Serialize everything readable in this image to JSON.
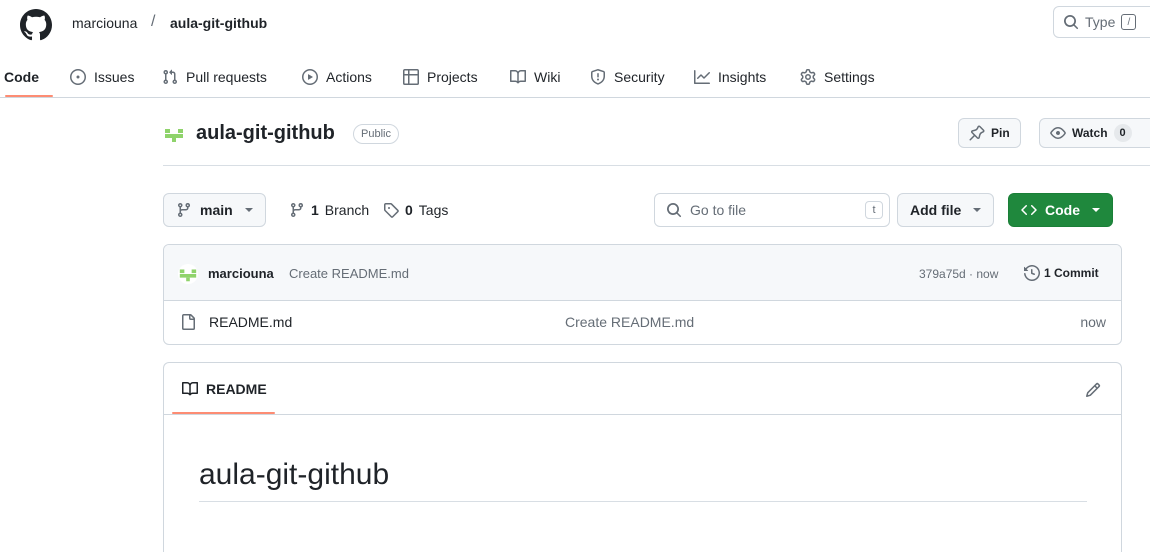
{
  "colors": {
    "accent": "#fd8c73",
    "code_button": "#1f883d",
    "border": "#d0d7de",
    "muted": "#656d76"
  },
  "header": {
    "owner": "marciouna",
    "separator": "/",
    "repo": "aula-git-github",
    "search_text": "Type",
    "search_kbd": "/",
    "icons": [
      "github-logo-icon",
      "search-icon"
    ]
  },
  "nav": {
    "code": "Code",
    "issues": "Issues",
    "pull_requests": "Pull requests",
    "actions": "Actions",
    "projects": "Projects",
    "wiki": "Wiki",
    "security": "Security",
    "insights": "Insights",
    "settings": "Settings"
  },
  "repo": {
    "name": "aula-git-github",
    "visibility": "Public",
    "pin_label": "Pin",
    "watch_label": "Watch",
    "watch_count": "0"
  },
  "toolbar": {
    "branch": "main",
    "branch_count": "1",
    "branch_word": "Branch",
    "tag_count": "0",
    "tag_word": "Tags",
    "goto_placeholder": "Go to file",
    "goto_kbd": "t",
    "add_file": "Add file",
    "code": "Code"
  },
  "latest_commit": {
    "author": "marciouna",
    "message": "Create README.md",
    "hash_time": "379a75d · now",
    "commit_count": "1 Commit"
  },
  "files": [
    {
      "name": "README.md",
      "message": "Create README.md",
      "time": "now"
    }
  ],
  "readme": {
    "tab": "README",
    "heading": "aula-git-github"
  }
}
